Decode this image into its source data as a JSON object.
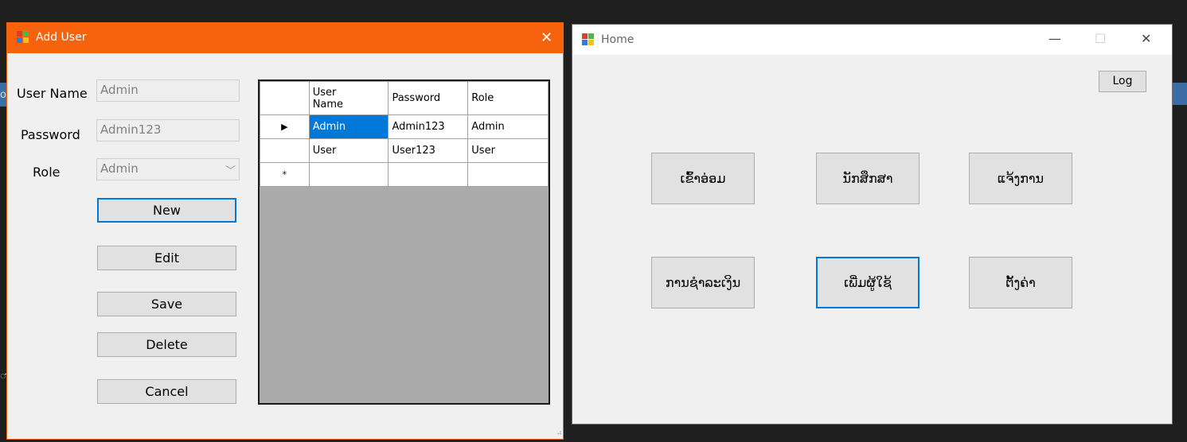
{
  "background": {
    "left_text_1": "ol",
    "left_text_2": "ា"
  },
  "add_user_window": {
    "title": "Add User",
    "close_glyph": "✕",
    "labels": {
      "username": "User Name",
      "password": "Password",
      "role": "Role"
    },
    "fields": {
      "username_value": "Admin",
      "password_value": "Admin123",
      "role_value": "Admin"
    },
    "buttons": {
      "new": "New",
      "edit": "Edit",
      "save": "Save",
      "delete": "Delete",
      "cancel": "Cancel"
    },
    "grid": {
      "columns": [
        "User Name",
        "Password",
        "Role"
      ],
      "rows": [
        {
          "indicator": "▶",
          "username": "Admin",
          "password": "Admin123",
          "role": "Admin",
          "selected_cell": "username"
        },
        {
          "indicator": "",
          "username": "User",
          "password": "User123",
          "role": "User"
        }
      ],
      "new_row_indicator": "*"
    }
  },
  "home_window": {
    "title": "Home",
    "controls": {
      "minimize": "—",
      "maximize": "☐",
      "close": "✕"
    },
    "log_button": "Log",
    "buttons": [
      {
        "label": "ເຂົ້າອ່ອມ"
      },
      {
        "label": "ນັກສຶກສາ"
      },
      {
        "label": "ແຈ້ງການ"
      },
      {
        "label": "ການຊຳລະເງິນ"
      },
      {
        "label": "ເພີ່ມຜູ້ໃຊ້"
      },
      {
        "label": "ຕັ້ງຄ່າ"
      }
    ]
  },
  "colors": {
    "accent_titlebar": "#f7630c",
    "selection": "#0078d7",
    "grid_background": "#ababab"
  }
}
